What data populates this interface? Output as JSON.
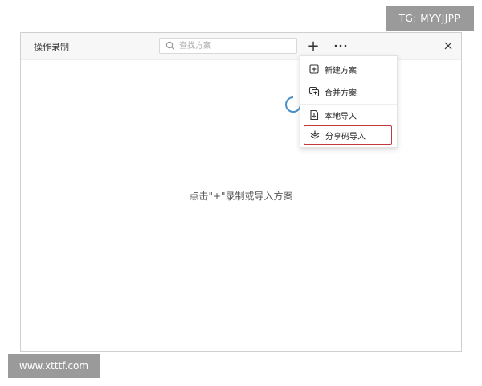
{
  "watermarks": {
    "top": "TG: MYYJJPP",
    "bottom": "www.xtttf.com"
  },
  "window": {
    "title": "操作录制",
    "search": {
      "placeholder": "查找方案",
      "value": ""
    },
    "toolbar": {
      "add_label": "+",
      "more_label": "···",
      "close_label": "×"
    },
    "empty_state": "点击\"+\"录制或导入方案"
  },
  "menu": {
    "items": [
      {
        "label": "新建方案",
        "icon": "new-file-icon"
      },
      {
        "label": "合并方案",
        "icon": "merge-icon"
      },
      {
        "label": "本地导入",
        "icon": "local-import-icon"
      },
      {
        "label": "分享码导入",
        "icon": "share-code-import-icon",
        "highlighted": true
      }
    ]
  },
  "colors": {
    "highlight_border": "#c0393b",
    "spinner": "#4a90c8"
  }
}
